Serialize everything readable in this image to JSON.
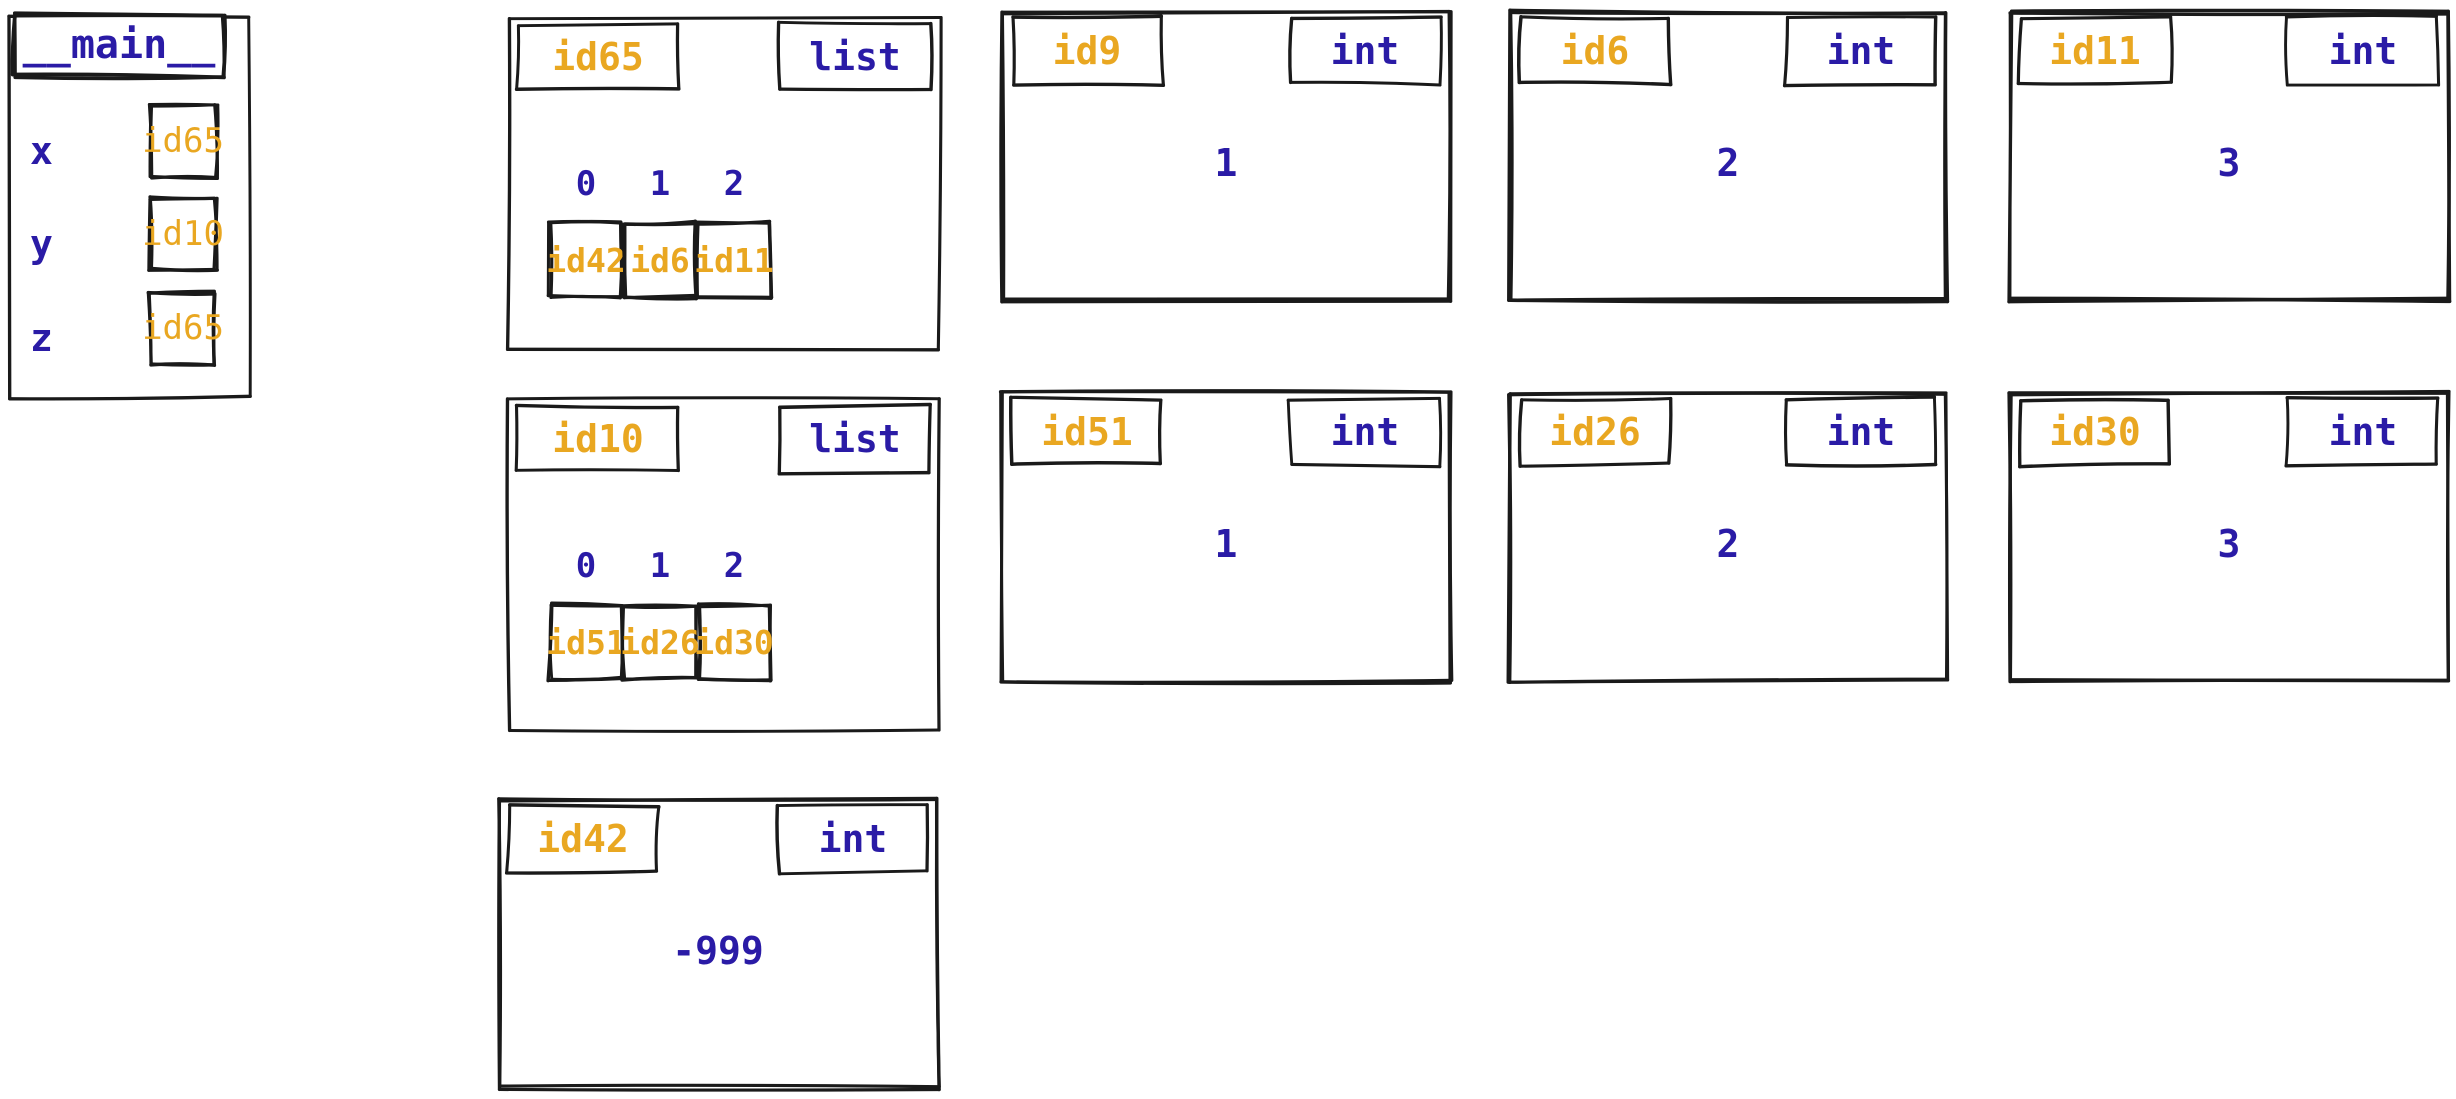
{
  "diagram": {
    "kind": "python-memory-model",
    "colors": {
      "id_orange": "#E9A721",
      "type_blue": "#2A1BA6",
      "stroke": "#1a1a1a",
      "background": "#ffffff"
    }
  },
  "stack_frame": {
    "title": "__main__",
    "variables": [
      {
        "name": "x",
        "value": "id65"
      },
      {
        "name": "y",
        "value": "id10"
      },
      {
        "name": "z",
        "value": "id65"
      }
    ]
  },
  "objects": [
    {
      "id": "id65",
      "type": "list",
      "indices": [
        "0",
        "1",
        "2"
      ],
      "elements": [
        "id42",
        "id6",
        "id11"
      ]
    },
    {
      "id": "id9",
      "type": "int",
      "value": "1"
    },
    {
      "id": "id6",
      "type": "int",
      "value": "2"
    },
    {
      "id": "id11",
      "type": "int",
      "value": "3"
    },
    {
      "id": "id10",
      "type": "list",
      "indices": [
        "0",
        "1",
        "2"
      ],
      "elements": [
        "id51",
        "id26",
        "id30"
      ]
    },
    {
      "id": "id51",
      "type": "int",
      "value": "1"
    },
    {
      "id": "id26",
      "type": "int",
      "value": "2"
    },
    {
      "id": "id30",
      "type": "int",
      "value": "3"
    },
    {
      "id": "id42",
      "type": "int",
      "value": "-999"
    }
  ]
}
